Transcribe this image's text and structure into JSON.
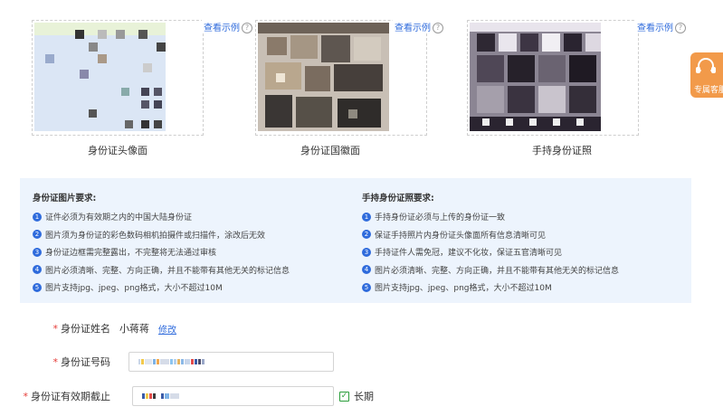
{
  "cards": [
    {
      "sample_label": "查看示例",
      "help": "?",
      "caption": "身份证头像面"
    },
    {
      "sample_label": "查看示例",
      "help": "?",
      "caption": "身份证国徽面"
    },
    {
      "sample_label": "查看示例",
      "help": "?",
      "caption": "手持身份证照"
    }
  ],
  "requirements": {
    "left": {
      "title": "身份证图片要求:",
      "items": [
        {
          "num": "1",
          "text": "证件必须为有效期之内的中国大陆身份证"
        },
        {
          "num": "2",
          "text": "图片须为身份证的彩色数码相机拍摄件或扫描件，涂改后无效"
        },
        {
          "num": "3",
          "text": "身份证边框需完整露出，不完整将无法通过审核"
        },
        {
          "num": "4",
          "text": "图片必须清晰、完整、方向正确，并且不能带有其他无关的标记信息"
        },
        {
          "num": "5",
          "text": "图片支持jpg、jpeg、png格式，大小不超过10M"
        }
      ]
    },
    "right": {
      "title": "手持身份证照要求:",
      "items": [
        {
          "num": "1",
          "text": "手持身份证必须与上传的身份证一致"
        },
        {
          "num": "2",
          "text": "保证手持照片内身份证头像面所有信息清晰可见"
        },
        {
          "num": "3",
          "text": "手持证件人需免冠，建议不化妆，保证五官清晰可见"
        },
        {
          "num": "4",
          "text": "图片必须清晰、完整、方向正确，并且不能带有其他无关的标记信息"
        },
        {
          "num": "5",
          "text": "图片支持jpg、jpeg、png格式，大小不超过10M"
        }
      ]
    }
  },
  "form": {
    "required_mark": "*",
    "name_label": "身份证姓名",
    "name_value": "小蒋蒋",
    "edit_link": "修改",
    "id_label": "身份证号码",
    "expiry_label": "身份证有效期截止",
    "long_term_label": "长期",
    "long_term_checked": true
  },
  "service": {
    "label": "专属客服"
  },
  "colors": {
    "accent": "#2f6bdc",
    "panel": "#edf4fd",
    "required": "#e53935",
    "check": "#2a9d3a",
    "service": "#f29a4a"
  }
}
